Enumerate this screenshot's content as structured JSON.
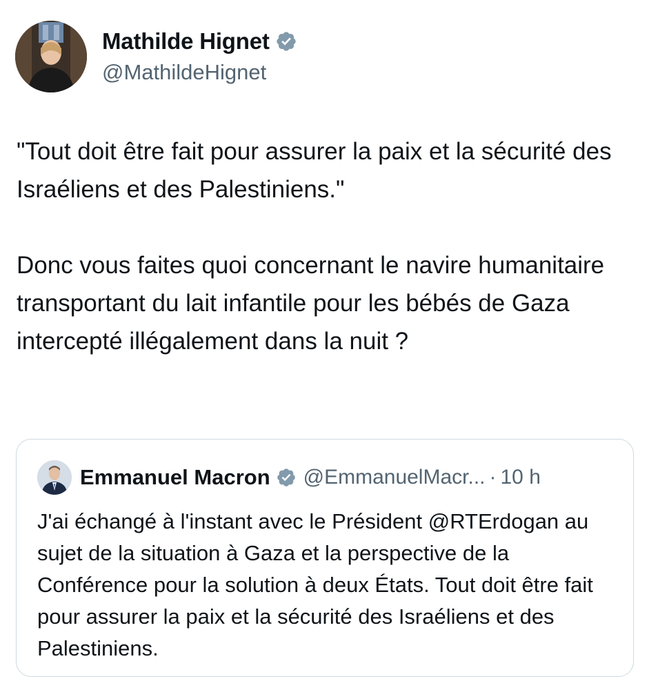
{
  "author": {
    "display_name": "Mathilde Hignet",
    "handle": "@MathildeHignet",
    "verified_icon": "verified-badge-icon"
  },
  "tweet": {
    "paragraphs": [
      "\"Tout doit être fait pour assurer la paix et la sécurité des Israéliens et des Palestiniens.\"",
      "Donc vous faites quoi concernant le navire humanitaire transportant du lait infantile pour les bébés de Gaza intercepté illégalement dans la nuit ?"
    ]
  },
  "quote": {
    "display_name": "Emmanuel Macron",
    "handle": "@EmmanuelMacr...",
    "separator": "·",
    "time": "10 h",
    "text": "J'ai échangé à l'instant avec le Président @RTErdogan au sujet de la situation à Gaza et la perspective de la Conférence pour la solution à deux États. Tout doit être fait pour assurer la paix et la sécurité des Israéliens et des Palestiniens."
  },
  "colors": {
    "text_primary": "#0f1419",
    "text_secondary": "#536471",
    "border": "#cfd9de",
    "verified_badge": "#829aab"
  }
}
